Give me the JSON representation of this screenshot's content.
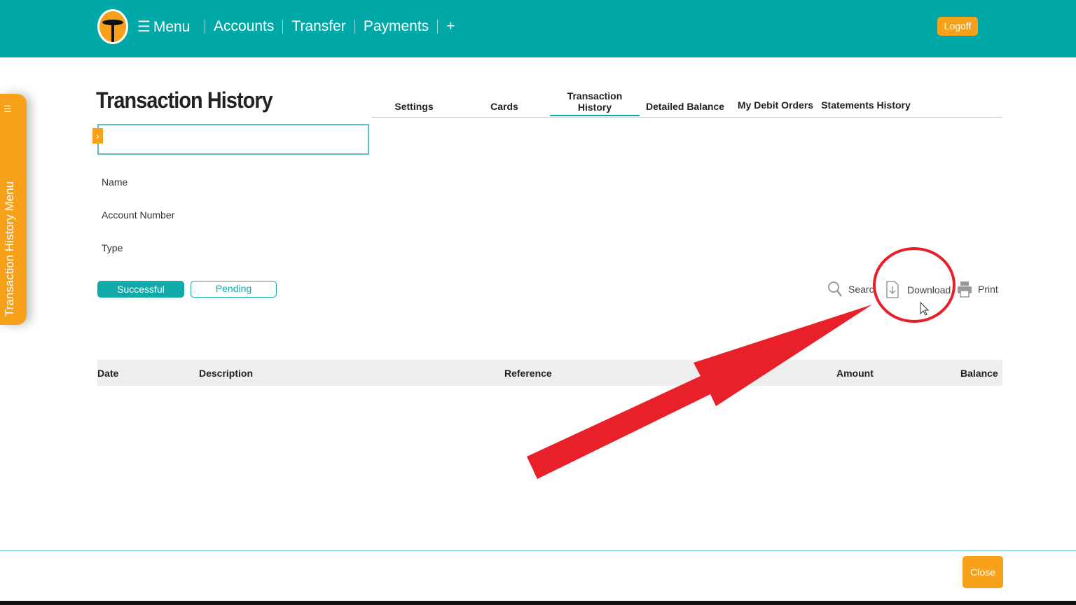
{
  "header": {
    "menu": "Menu",
    "nav": [
      "Accounts",
      "Transfer",
      "Payments",
      "+"
    ],
    "logoff": "Logoff"
  },
  "sidebar": {
    "label": "Transaction History Menu",
    "icon": "hamburger-icon"
  },
  "page": {
    "title": "Transaction History"
  },
  "tabs": [
    {
      "label": "Settings"
    },
    {
      "label": "Cards"
    },
    {
      "label": "Transaction History",
      "active": true
    },
    {
      "label": "Detailed Balance"
    },
    {
      "label": "My Debit Orders"
    },
    {
      "label": "Statements History"
    }
  ],
  "fields": {
    "name": "Name",
    "account_number": "Account Number",
    "type": "Type"
  },
  "filters": {
    "successful": "Successful",
    "pending": "Pending"
  },
  "actions": {
    "search": "Searc",
    "download": "Download",
    "print": "Print"
  },
  "table": {
    "columns": [
      "Date",
      "Description",
      "Reference",
      "Amount",
      "Balance"
    ]
  },
  "footer": {
    "close": "Close"
  },
  "colors": {
    "teal": "#00a8a8",
    "orange": "#f7a11a",
    "annotation_red": "#e8202a"
  }
}
